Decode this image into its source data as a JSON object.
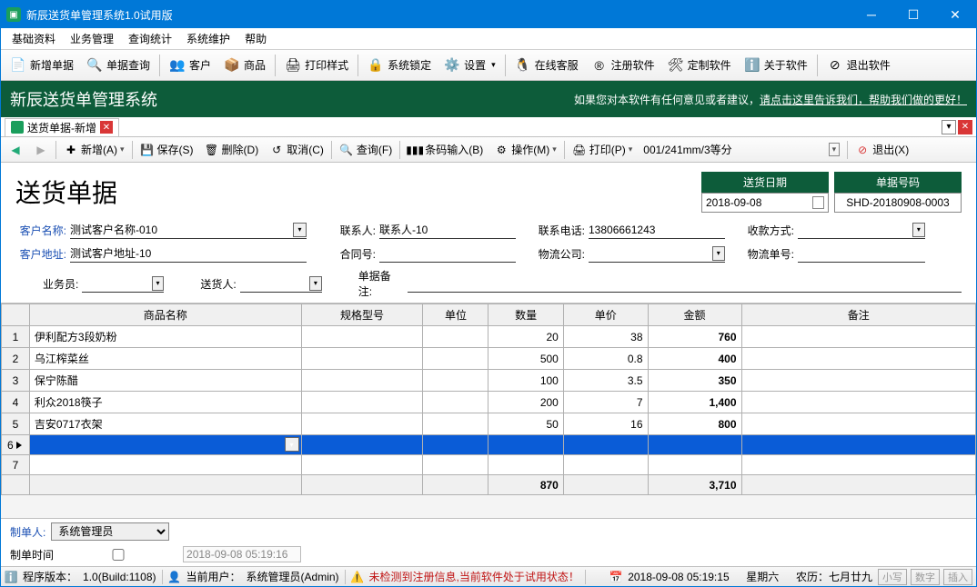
{
  "window": {
    "title": "新辰送货单管理系统1.0试用版"
  },
  "menu": [
    "基础资料",
    "业务管理",
    "查询统计",
    "系统维护",
    "帮助"
  ],
  "toolbar": [
    {
      "icon": "📄",
      "label": "新增单据"
    },
    {
      "icon": "🔍",
      "label": "单据查询"
    },
    {
      "sep": true
    },
    {
      "icon": "👥",
      "label": "客户"
    },
    {
      "icon": "📦",
      "label": "商品"
    },
    {
      "sep": true
    },
    {
      "icon": "🖨",
      "label": "打印样式"
    },
    {
      "sep": true
    },
    {
      "icon": "🔒",
      "label": "系统锁定"
    },
    {
      "icon": "⚙️",
      "label": "设置",
      "dd": true
    },
    {
      "sep": true
    },
    {
      "icon": "🐧",
      "label": "在线客服"
    },
    {
      "icon": "®",
      "label": "注册软件"
    },
    {
      "icon": "🛠",
      "label": "定制软件"
    },
    {
      "icon": "ℹ️",
      "label": "关于软件"
    },
    {
      "sep": true
    },
    {
      "icon": "⊘",
      "label": "退出软件"
    }
  ],
  "header": {
    "system_name": "新辰送货单管理系统",
    "tip_prefix": "如果您对本软件有任何意见或者建议，",
    "tip_link": "请点击这里告诉我们，帮助我们做的更好！"
  },
  "tab": {
    "label": "送货单据-新增"
  },
  "doc_toolbar": {
    "nav_back": "◁",
    "nav_fwd": "▷",
    "new": "新增(A)",
    "save": "保存(S)",
    "delete": "删除(D)",
    "cancel": "取消(C)",
    "query": "查询(F)",
    "barcode": "条码输入(B)",
    "operate": "操作(M)",
    "print": "打印(P)",
    "print_spec": "001/241mm/3等分",
    "exit": "退出(X)"
  },
  "form": {
    "title": "送货单据",
    "date_label": "送货日期",
    "date_value": "2018-09-08",
    "no_label": "单据号码",
    "no_value": "SHD-20180908-0003",
    "labels": {
      "customer": "客户名称:",
      "address": "客户地址:",
      "sales": "业务员:",
      "deliverer": "送货人:",
      "contact": "联系人:",
      "contract": "合同号:",
      "phone": "联系电话:",
      "logistics": "物流公司:",
      "pay": "收款方式:",
      "trackno": "物流单号:",
      "note": "单据备注:"
    },
    "values": {
      "customer": "测试客户名称-010",
      "address": "测试客户地址-10",
      "contact": "联系人-10",
      "phone": "13806661243"
    }
  },
  "table": {
    "headers": [
      "商品名称",
      "规格型号",
      "单位",
      "数量",
      "单价",
      "金额",
      "备注"
    ],
    "rows": [
      {
        "name": "伊利配方3段奶粉",
        "spec": "",
        "unit": "",
        "qty": "20",
        "price": "38",
        "amount": "760",
        "remark": ""
      },
      {
        "name": "乌江榨菜丝",
        "spec": "",
        "unit": "",
        "qty": "500",
        "price": "0.8",
        "amount": "400",
        "remark": ""
      },
      {
        "name": "保宁陈醋",
        "spec": "",
        "unit": "",
        "qty": "100",
        "price": "3.5",
        "amount": "350",
        "remark": ""
      },
      {
        "name": "利众2018筷子",
        "spec": "",
        "unit": "",
        "qty": "200",
        "price": "7",
        "amount": "1,400",
        "remark": ""
      },
      {
        "name": "吉安0717衣架",
        "spec": "",
        "unit": "",
        "qty": "50",
        "price": "16",
        "amount": "800",
        "remark": ""
      }
    ],
    "totals": {
      "qty": "870",
      "amount": "3,710"
    }
  },
  "footer": {
    "maker_label": "制单人:",
    "maker_value": "系统管理员",
    "maketime_label": "制单时间",
    "maketime_value": "2018-09-08 05:19:16"
  },
  "status": {
    "version_label": "程序版本：",
    "version": "1.0(Build:1108)",
    "user_label": "当前用户：",
    "user": "系统管理员(Admin)",
    "warn": "未检测到注册信息,当前软件处于试用状态！",
    "datetime": "2018-09-08 05:19:15",
    "weekday": "星期六",
    "lunar": "农历：七月廿九",
    "ind": [
      "小写",
      "数字",
      "插入"
    ]
  }
}
